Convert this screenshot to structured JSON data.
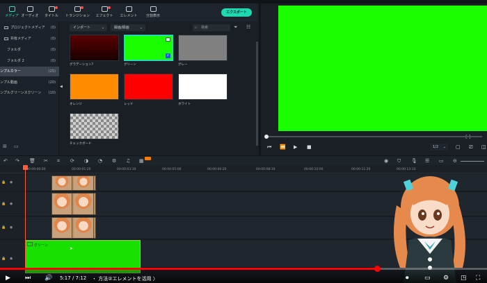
{
  "toolbar": {
    "tabs": [
      {
        "label": "メディア",
        "icon": "media-icon",
        "active": true
      },
      {
        "label": "オーディオ",
        "icon": "audio-icon"
      },
      {
        "label": "タイトル",
        "icon": "title-icon",
        "badge": true
      },
      {
        "label": "トランジション",
        "icon": "transition-icon",
        "badge": true
      },
      {
        "label": "エフェクト",
        "icon": "effect-icon",
        "badge": true
      },
      {
        "label": "エレメント",
        "icon": "element-icon"
      },
      {
        "label": "分割表示",
        "icon": "split-screen-icon"
      }
    ],
    "export_label": "エクスポート"
  },
  "sidebar": {
    "items": [
      {
        "name": "プロジェクトメディア",
        "count": "(0)"
      },
      {
        "name": "共有メディア",
        "count": "(0)"
      },
      {
        "name": "フォルダ",
        "count": "(0)"
      },
      {
        "name": "フォルダ 2",
        "count": "(0)"
      },
      {
        "name": "ンプルカラー",
        "count": "(25)",
        "selected": true
      },
      {
        "name": "ンプル動画",
        "count": "(20)"
      },
      {
        "name": "ンプルグリーンスクリーン",
        "count": "(10)"
      }
    ]
  },
  "media": {
    "import_label": "インポート",
    "sort_label": "録画/録画",
    "search_placeholder": "検索",
    "items": [
      {
        "label": "グラデーション7",
        "color": "#8b0000",
        "kind": "gradient"
      },
      {
        "label": "グリーン",
        "color": "#1aff00",
        "selected": true
      },
      {
        "label": "グレー",
        "color": "#808080"
      },
      {
        "label": "オレンジ",
        "color": "#ff8c00"
      },
      {
        "label": "レッド",
        "color": "#ff0000"
      },
      {
        "label": "ホワイト",
        "color": "#ffffff"
      },
      {
        "label": "チェックボード",
        "kind": "checker"
      }
    ]
  },
  "preview": {
    "screen_color": "#1aff00",
    "zoom": "1/2"
  },
  "timeline": {
    "ruler": [
      "00:00:00:00",
      "00:00:01:20",
      "00:00:03:10",
      "00:00:05:00",
      "00:00:06:20",
      "00:00:08:10",
      "00:00:10:00",
      "00:00:11:20",
      "00:00:13:10"
    ],
    "green_clip_label": "グリーン"
  },
  "youtube": {
    "progress": 0.776,
    "time": "5:17 / 7:12",
    "chapter": "・ 方法②エレメントを活用 〉"
  }
}
